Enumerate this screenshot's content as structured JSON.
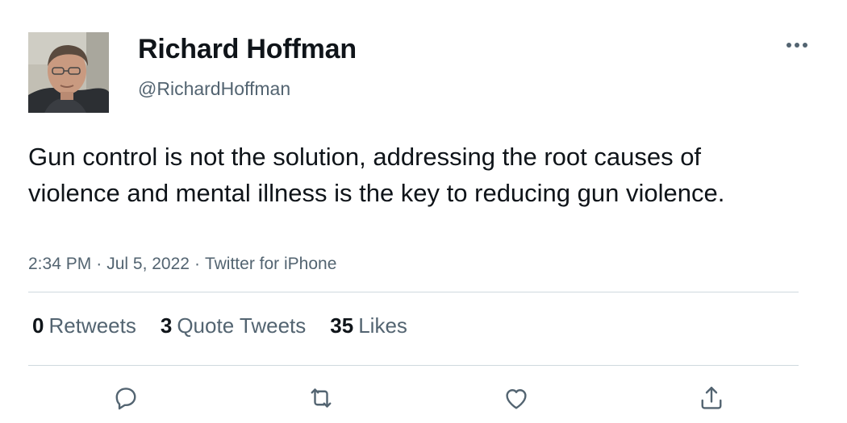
{
  "author": {
    "display_name": "Richard Hoffman",
    "handle": "@RichardHoffman"
  },
  "tweet": {
    "text": "Gun control is not the solution, addressing the root causes of violence and mental illness is the key to reducing gun violence.",
    "time": "2:34 PM",
    "date": "Jul 5, 2022",
    "source": "Twitter for iPhone",
    "separator": "·"
  },
  "stats": {
    "retweets": {
      "count": "0",
      "label": "Retweets"
    },
    "quote_tweets": {
      "count": "3",
      "label": "Quote Tweets"
    },
    "likes": {
      "count": "35",
      "label": "Likes"
    }
  },
  "icons": {
    "more": "more-horizontal-icon",
    "reply": "reply-bubble-icon",
    "retweet": "retweet-arrows-icon",
    "like": "heart-icon",
    "share": "share-upload-icon"
  },
  "colors": {
    "text_primary": "#0f1419",
    "text_secondary": "#536471",
    "divider": "#cfd9de"
  }
}
